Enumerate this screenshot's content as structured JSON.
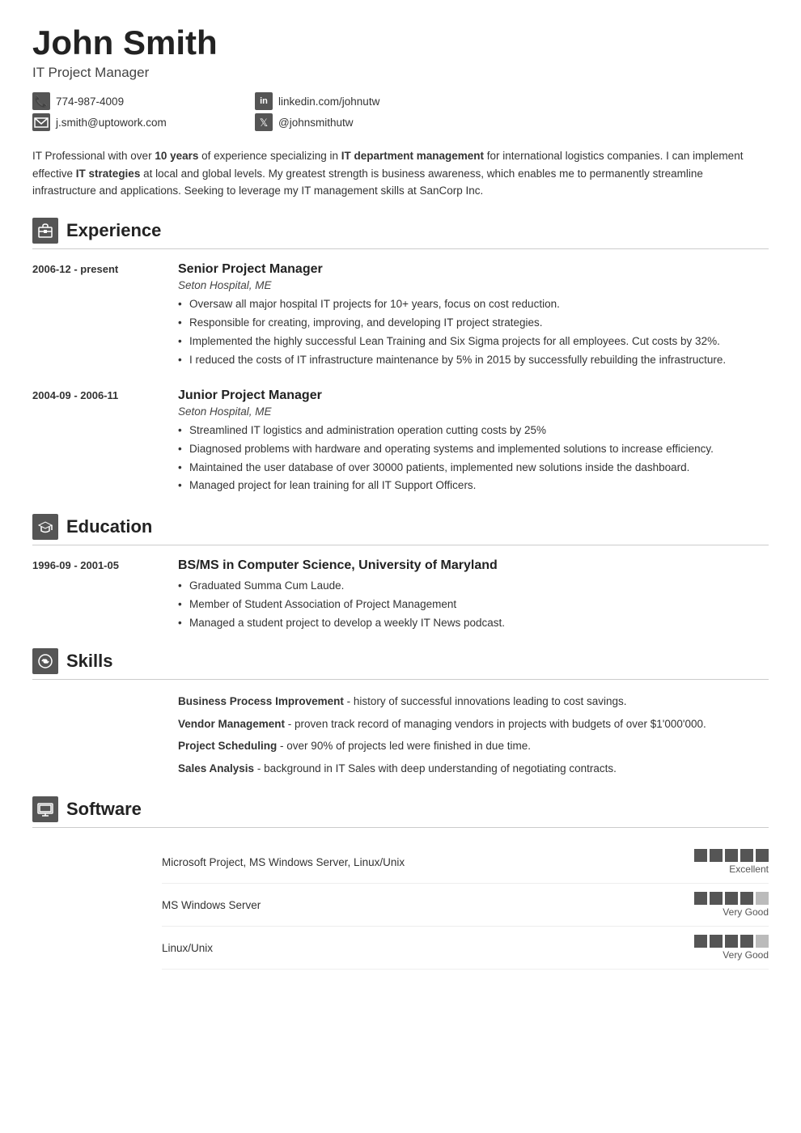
{
  "header": {
    "name": "John Smith",
    "title": "IT Project Manager",
    "contacts": [
      {
        "icon": "phone",
        "text": "774-987-4009",
        "iconLabel": "phone-icon"
      },
      {
        "icon": "linkedin",
        "text": "linkedin.com/johnutw",
        "iconLabel": "linkedin-icon"
      },
      {
        "icon": "email",
        "text": "j.smith@uptowork.com",
        "iconLabel": "email-icon"
      },
      {
        "icon": "twitter",
        "text": "@johnsmithutw",
        "iconLabel": "twitter-icon"
      }
    ]
  },
  "summary": {
    "text_plain": "IT Professional with over 10 years of experience specializing in IT department management for international logistics companies. I can implement effective IT strategies at local and global levels. My greatest strength is business awareness, which enables me to permanently streamline infrastructure and applications. Seeking to leverage my IT management skills at SanCorp Inc."
  },
  "sections": {
    "experience": {
      "title": "Experience",
      "entries": [
        {
          "dates": "2006-12 - present",
          "role": "Senior Project Manager",
          "company": "Seton Hospital, ME",
          "bullets": [
            "Oversaw all major hospital IT projects for 10+ years, focus on cost reduction.",
            "Responsible for creating, improving, and developing IT project strategies.",
            "Implemented the highly successful Lean Training and Six Sigma projects for all employees. Cut costs by 32%.",
            "I reduced the costs of IT infrastructure maintenance by 5% in 2015 by successfully rebuilding the infrastructure."
          ]
        },
        {
          "dates": "2004-09 - 2006-11",
          "role": "Junior Project Manager",
          "company": "Seton Hospital, ME",
          "bullets": [
            "Streamlined IT logistics and administration operation cutting costs by 25%",
            "Diagnosed problems with hardware and operating systems and implemented solutions to increase efficiency.",
            "Maintained the user database of over 30000 patients, implemented new solutions inside the dashboard.",
            "Managed project for lean training for all IT Support Officers."
          ]
        }
      ]
    },
    "education": {
      "title": "Education",
      "entries": [
        {
          "dates": "1996-09 - 2001-05",
          "degree": "BS/MS in Computer Science, University of Maryland",
          "bullets": [
            "Graduated Summa Cum Laude.",
            "Member of Student Association of Project Management",
            "Managed a student project to develop a weekly IT News podcast."
          ]
        }
      ]
    },
    "skills": {
      "title": "Skills",
      "items": [
        {
          "name": "Business Process Improvement",
          "desc": "history of successful innovations leading to cost savings."
        },
        {
          "name": "Vendor Management",
          "desc": "proven track record of managing vendors in projects with budgets of over $1'000'000."
        },
        {
          "name": "Project Scheduling",
          "desc": "over 90% of projects led were finished in due time."
        },
        {
          "name": "Sales Analysis",
          "desc": "background in IT Sales with deep understanding of negotiating contracts."
        }
      ]
    },
    "software": {
      "title": "Software",
      "items": [
        {
          "name": "Microsoft Project, MS Windows Server, Linux/Unix",
          "rating": 5,
          "max": 5,
          "label": "Excellent"
        },
        {
          "name": "MS Windows Server",
          "rating": 4,
          "max": 5,
          "label": "Very Good"
        },
        {
          "name": "Linux/Unix",
          "rating": 4,
          "max": 5,
          "label": "Very Good"
        }
      ]
    }
  }
}
